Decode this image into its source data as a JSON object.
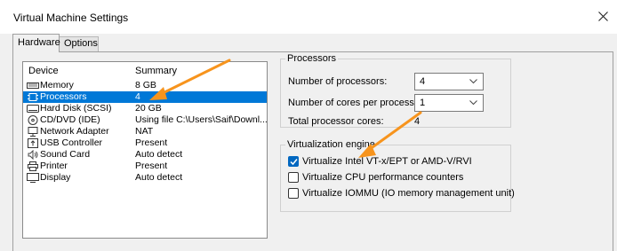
{
  "window": {
    "title": "Virtual Machine Settings",
    "close_glyph": "×"
  },
  "tabs": [
    {
      "label": "Hardware",
      "active": true
    },
    {
      "label": "Options",
      "active": false
    }
  ],
  "device_list": {
    "columns": {
      "device": "Device",
      "summary": "Summary"
    },
    "rows": [
      {
        "device": "Memory",
        "summary": "8 GB",
        "icon": "memory-icon",
        "selected": false
      },
      {
        "device": "Processors",
        "summary": "4",
        "icon": "processor-icon",
        "selected": true
      },
      {
        "device": "Hard Disk (SCSI)",
        "summary": "20 GB",
        "icon": "hard-disk-icon",
        "selected": false
      },
      {
        "device": "CD/DVD (IDE)",
        "summary": "Using file C:\\Users\\Saif\\Downl...",
        "icon": "cd-dvd-icon",
        "selected": false
      },
      {
        "device": "Network Adapter",
        "summary": "NAT",
        "icon": "network-adapter-icon",
        "selected": false
      },
      {
        "device": "USB Controller",
        "summary": "Present",
        "icon": "usb-icon",
        "selected": false
      },
      {
        "device": "Sound Card",
        "summary": "Auto detect",
        "icon": "speaker-icon",
        "selected": false
      },
      {
        "device": "Printer",
        "summary": "Present",
        "icon": "printer-icon",
        "selected": false
      },
      {
        "device": "Display",
        "summary": "Auto detect",
        "icon": "display-icon",
        "selected": false
      }
    ]
  },
  "processors": {
    "group_label": "Processors",
    "num_processors_label": "Number of processors:",
    "num_processors_value": "4",
    "cores_label": "Number of cores per processor:",
    "cores_value": "1",
    "total_label": "Total processor cores:",
    "total_value": "4"
  },
  "virtualization": {
    "group_label": "Virtualization engine",
    "options": [
      {
        "label": "Virtualize Intel VT-x/EPT or AMD-V/RVI",
        "checked": true
      },
      {
        "label": "Virtualize CPU performance counters",
        "checked": false
      },
      {
        "label": "Virtualize IOMMU (IO memory management unit)",
        "checked": false
      }
    ]
  },
  "colors": {
    "selection": "#0078d7",
    "checkbox_on": "#0067c0",
    "annotation_arrow": "#f7941d"
  }
}
